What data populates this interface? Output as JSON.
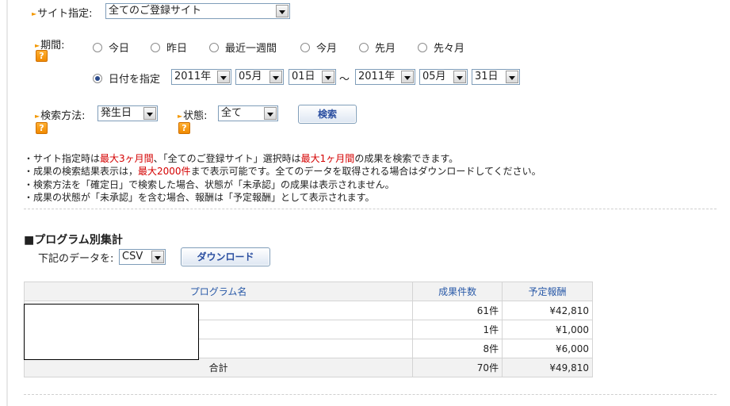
{
  "site": {
    "label": "サイト指定:",
    "value": "全てのご登録サイト"
  },
  "period": {
    "label": "期間:",
    "options": [
      "今日",
      "昨日",
      "最近一週間",
      "今月",
      "先月",
      "先々月"
    ],
    "custom_label": "日付を指定",
    "from": {
      "year": "2011年",
      "month": "05月",
      "day": "01日"
    },
    "sep": "～",
    "to": {
      "year": "2011年",
      "month": "05月",
      "day": "31日"
    }
  },
  "search": {
    "method_label": "検索方法:",
    "method_value": "発生日",
    "status_label": "状態:",
    "status_value": "全て",
    "button": "検索"
  },
  "help_icon": "question-icon",
  "notes": {
    "n1_a": "・サイト指定時は",
    "n1_b": "最大3ヶ月間",
    "n1_c": "、「全てのご登録サイト」選択時は",
    "n1_d": "最大1ヶ月間",
    "n1_e": "の成果を検索できます。",
    "n2_a": "・成果の検索結果表示は，",
    "n2_b": "最大2000件",
    "n2_c": "まで表示可能です。全てのデータを取得される場合はダウンロードしてください。",
    "n3": "・検索方法を「確定日」で検索した場合、状態が「未承認」の成果は表示されません。",
    "n4": "・成果の状態が「未承認」を含む場合、報酬は「予定報酬」として表示されます。"
  },
  "program": {
    "square": "■",
    "title": "プログラム別集計",
    "download_label": "下記のデータを:",
    "format": "CSV",
    "download_button": "ダウンロード"
  },
  "table": {
    "headers": [
      "プログラム名",
      "成果件数",
      "予定報酬"
    ],
    "rows": [
      {
        "name": "",
        "count": "61件",
        "amount": "¥42,810"
      },
      {
        "name": "",
        "count": "1件",
        "amount": "¥1,000"
      },
      {
        "name": "",
        "count": "8件",
        "amount": "¥6,000"
      }
    ],
    "total": {
      "label": "合計",
      "count": "70件",
      "amount": "¥49,810"
    }
  },
  "colors": {
    "accent_orange": "#f39800",
    "link_blue": "#2a5aa8",
    "warning_red": "#d40000"
  }
}
